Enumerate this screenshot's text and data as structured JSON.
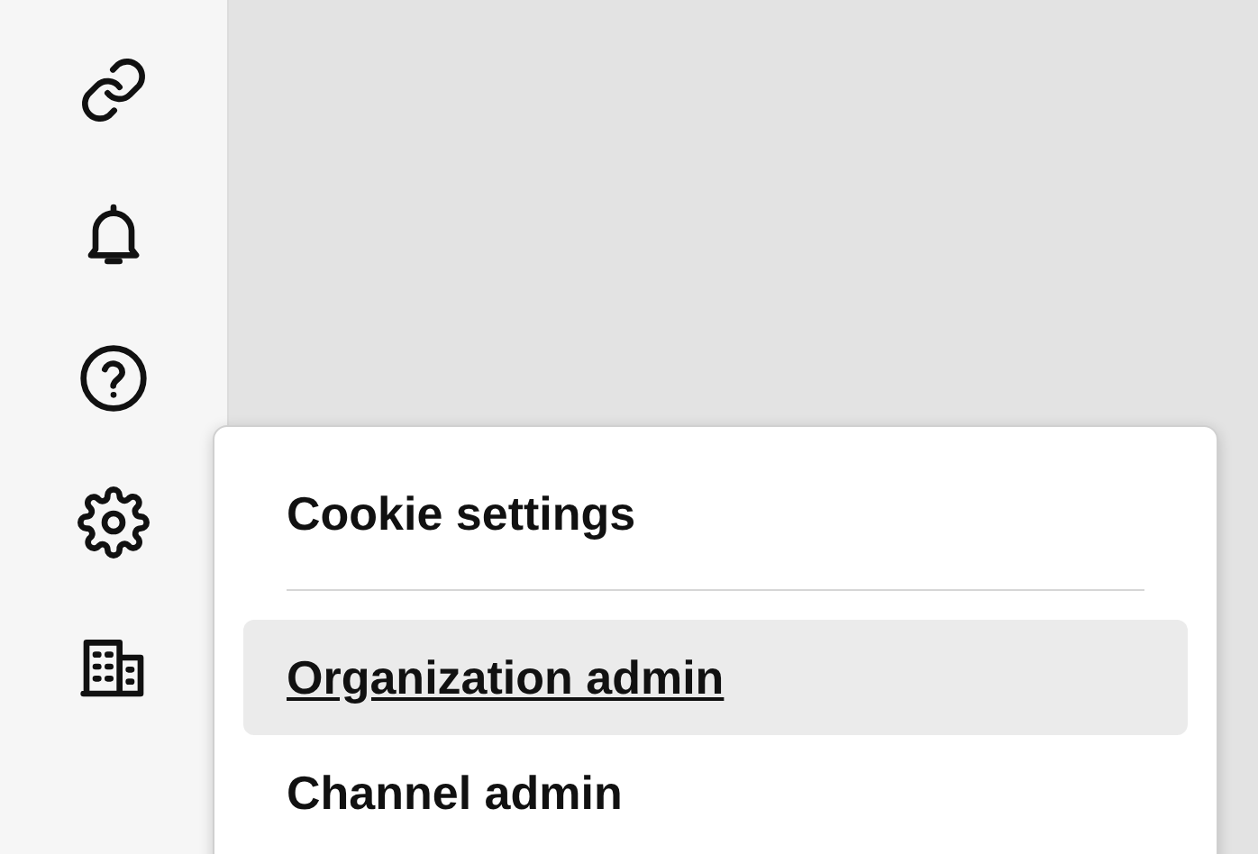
{
  "menu": {
    "sections": [
      [
        {
          "label": "Cookie settings",
          "selected": false
        }
      ],
      [
        {
          "label": "Organization admin",
          "selected": true
        },
        {
          "label": "Channel admin",
          "selected": false
        }
      ]
    ]
  }
}
